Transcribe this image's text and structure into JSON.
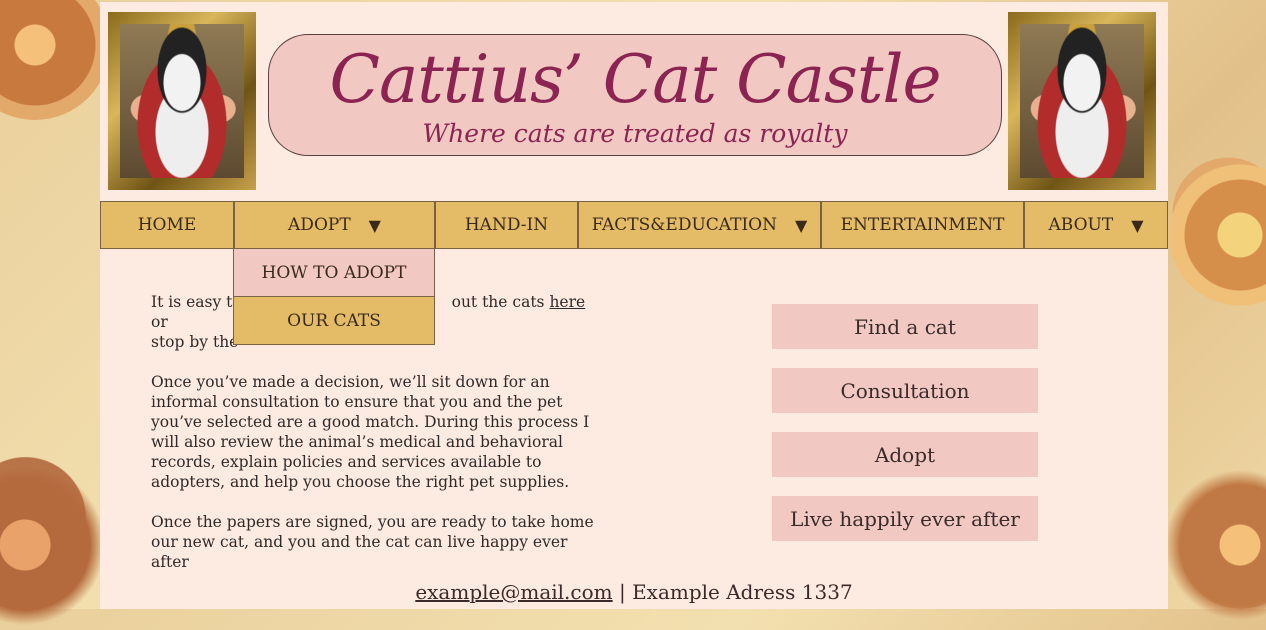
{
  "header": {
    "title": "Cattius’ Cat Castle",
    "subtitle": "Where cats are treated as royalty"
  },
  "nav": {
    "items": [
      {
        "label": "HOME",
        "has_dropdown": false
      },
      {
        "label": "ADOPT",
        "has_dropdown": true
      },
      {
        "label": "HAND-IN",
        "has_dropdown": false
      },
      {
        "label": "FACTS&EDUCATION",
        "has_dropdown": true
      },
      {
        "label": "ENTERTAINMENT",
        "has_dropdown": false
      },
      {
        "label": "ABOUT",
        "has_dropdown": true
      }
    ],
    "arrow": "▼",
    "dropdown": [
      "HOW TO ADOPT",
      "OUR CATS"
    ]
  },
  "content": {
    "p1_start": "It is easy to",
    "p1_mid": "out the cats",
    "p1_link": "here",
    "p1_after": "or",
    "p1_line2": "stop by the",
    "p2": "Once you’ve made a decision, we’ll sit down for an informal consultation to ensure that you and the pet you’ve selected are a good match. During this process I will also review the animal’s medical and behavioral records, explain policies and services available to adopters, and help you choose the right pet supplies.",
    "p3": "Once the papers are signed, you are ready to take home our new cat, and you and the cat can live happy ever after"
  },
  "steps": [
    "Find a cat",
    "Consultation",
    "Adopt",
    "Live happily ever after"
  ],
  "footer": {
    "email": "example@mail.com",
    "separator": "|",
    "address": "Example Adress 1337"
  },
  "colors": {
    "page_bg": "#fdeae0",
    "nav_bg": "#e4bb66",
    "accent_pink": "#f1c9c2",
    "title_color": "#8b2452"
  }
}
